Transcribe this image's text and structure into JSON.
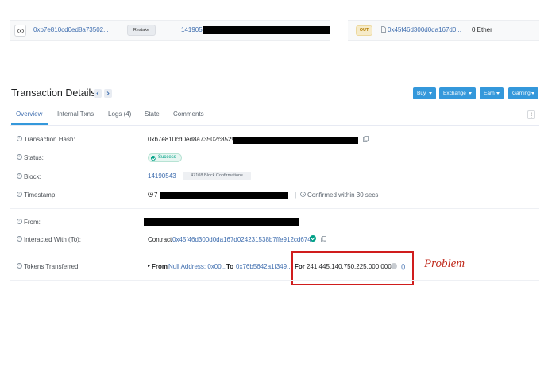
{
  "tx_row": {
    "hash": "0xb7e810cd0ed8a73502...",
    "method": "Restake",
    "block": "14190543"
  },
  "out_row": {
    "badge": "OUT",
    "address": "0x45f46d300d0da167d0...",
    "amount": "0 Ether"
  },
  "header": {
    "title": "Transaction Details",
    "buttons": [
      "Buy",
      "Exchange",
      "Earn",
      "Gaming"
    ]
  },
  "tabs": [
    "Overview",
    "Internal Txns",
    "Logs (4)",
    "State",
    "Comments"
  ],
  "details": {
    "tx_hash_label": "Transaction Hash:",
    "tx_hash_value": "0xb7e810cd0ed8a73502c85299",
    "status_label": "Status:",
    "status_value": "Success",
    "block_label": "Block:",
    "block_value": "14190543",
    "block_confirmations": "47108 Block Confirmations",
    "timestamp_label": "Timestamp:",
    "timestamp_prefix": "7 d",
    "timestamp_confirmed": "Confirmed within 30 secs",
    "from_label": "From:",
    "interacted_label": "Interacted With (To):",
    "interacted_prefix": "Contract",
    "interacted_address": "0x45f46d300d0da167d024231538b7ffe912cd674e",
    "tokens_label": "Tokens Transferred:",
    "tokens_from_label": "From",
    "tokens_from_value": "Null Address: 0x00...",
    "tokens_to_label": "To",
    "tokens_to_value": "0x76b5642a1f349...",
    "tokens_for_label": "For",
    "tokens_amount": "241,445,140,750,225,000,000",
    "tokens_suffix": "()"
  },
  "annotation": {
    "text": "Problem",
    "color": "#d01d1d"
  },
  "colors": {
    "link": "#3f6eaf",
    "button": "#3498db",
    "success": "#00a186"
  }
}
